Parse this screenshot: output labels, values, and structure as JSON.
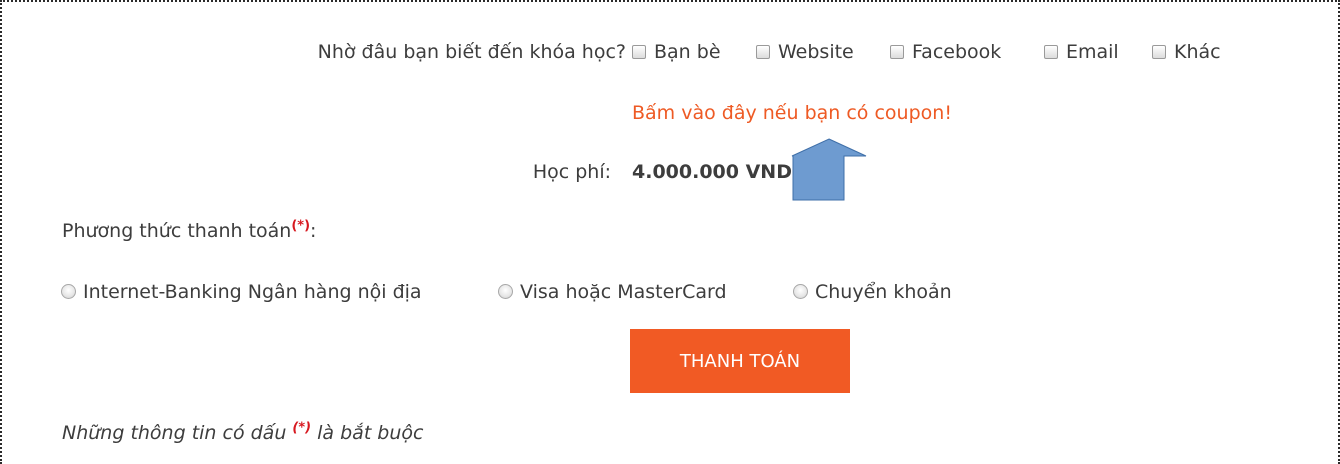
{
  "referral": {
    "question": "Nhờ đâu bạn biết đến khóa học?",
    "options": [
      {
        "label": "Bạn bè",
        "checked": false
      },
      {
        "label": "Website",
        "checked": false
      },
      {
        "label": "Facebook",
        "checked": false
      },
      {
        "label": "Email",
        "checked": false
      },
      {
        "label": "Khác",
        "checked": false
      }
    ]
  },
  "coupon": {
    "link_text": "Bấm vào đây nếu bạn có coupon!"
  },
  "fee": {
    "label": "Học phí:",
    "value": "4.000.000 VND"
  },
  "payment": {
    "label": "Phương thức thanh toán",
    "required_mark": "(*)",
    "colon": ":",
    "methods": [
      {
        "label": "Internet-Banking Ngân hàng nội địa",
        "selected": false
      },
      {
        "label": "Visa hoặc MasterCard",
        "selected": false
      },
      {
        "label": "Chuyển khoản",
        "selected": false
      }
    ],
    "submit_label": "THANH TOÁN"
  },
  "footnote": {
    "prefix": "Những thông tin có dấu",
    "mark": "(*)",
    "suffix": "là bắt buộc"
  },
  "annotation": {
    "icon": "up-arrow-icon",
    "fill_color": "#6e9bd0",
    "stroke_color": "#3f6fa8"
  },
  "colors": {
    "accent": "#f15a24",
    "link": "#ee5a24",
    "required": "#d71920",
    "text": "#3d3d3d"
  }
}
